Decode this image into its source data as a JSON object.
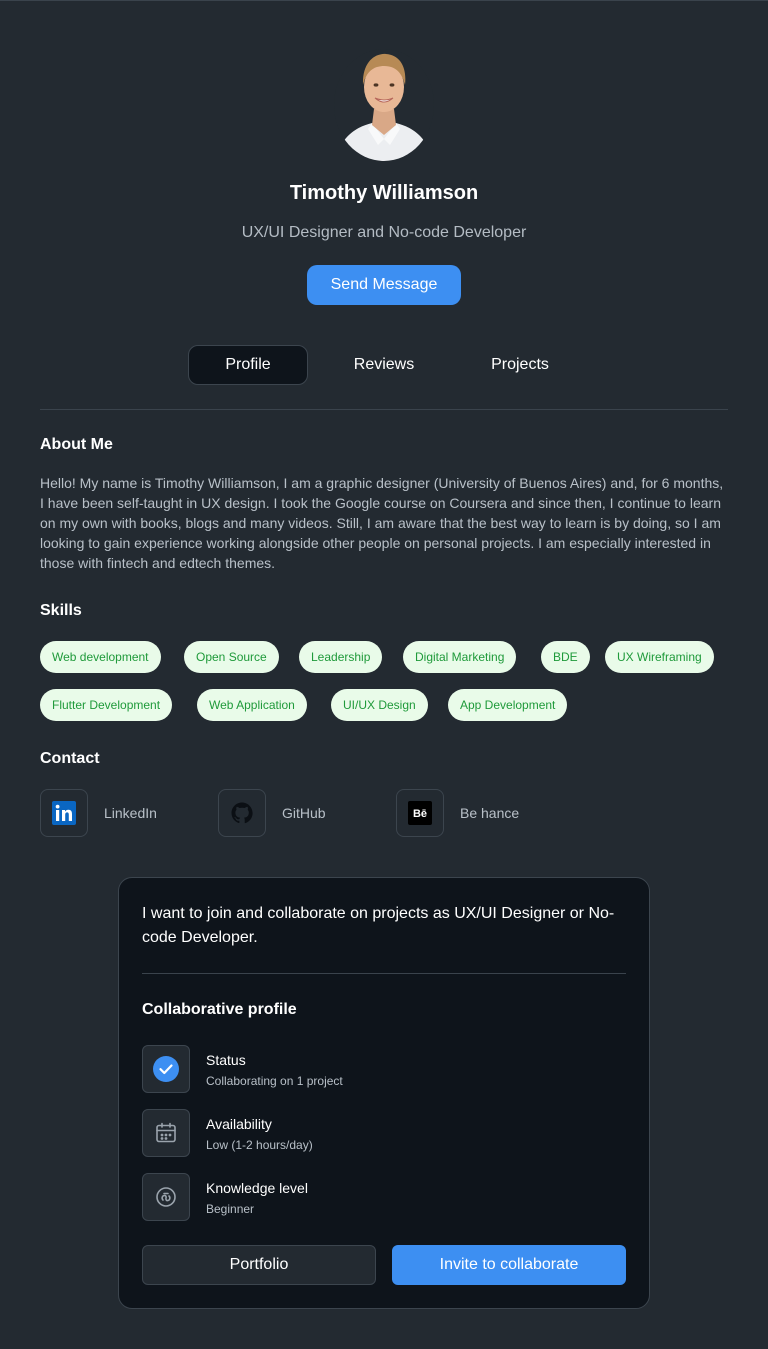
{
  "profile": {
    "name": "Timothy Williamson",
    "role": "UX/UI Designer and No-code Developer",
    "send_message_label": "Send Message"
  },
  "tabs": [
    {
      "label": "Profile",
      "active": true
    },
    {
      "label": "Reviews",
      "active": false
    },
    {
      "label": "Projects",
      "active": false
    }
  ],
  "about": {
    "title": "About Me",
    "text": "Hello! My name is Timothy Williamson, I am a graphic designer (University of Buenos Aires) and, for 6 months, I have been self-taught in UX design. I took the Google course on Coursera and since then, I continue to learn on my own with books, blogs and many videos. Still, I am aware that the best way to learn is by doing, so I am looking to gain experience working alongside other people on personal projects. I am especially interested in those with fintech and edtech themes."
  },
  "skills": {
    "title": "Skills",
    "items": [
      "Web development",
      "Open Source",
      "Leadership",
      "Digital Marketing",
      "BDE",
      "UX Wireframing",
      "Flutter Development",
      "Web Application",
      "UI/UX Design",
      "App Development"
    ]
  },
  "contact": {
    "title": "Contact",
    "items": [
      {
        "label": "LinkedIn",
        "icon": "linkedin-icon"
      },
      {
        "label": "GitHub",
        "icon": "github-icon"
      },
      {
        "label": "Be hance",
        "icon": "behance-icon"
      }
    ]
  },
  "collab_card": {
    "intro": "I want to join and collaborate on projects  as UX/UI Designer or No-code Developer.",
    "title": "Collaborative profile",
    "rows": [
      {
        "label": "Status",
        "value": "Collaborating on 1 project",
        "icon": "check-circle-icon"
      },
      {
        "label": "Availability",
        "value": "Low (1-2 hours/day)",
        "icon": "calendar-icon"
      },
      {
        "label": "Knowledge level",
        "value": "Beginner",
        "icon": "knowledge-icon"
      }
    ],
    "portfolio_label": "Portfolio",
    "invite_label": "Invite to collaborate"
  },
  "colors": {
    "background": "#232a31",
    "card": "#0e141b",
    "accent": "#3d8ff2",
    "chip_bg": "#e9fbe9",
    "chip_text": "#1f9a3a"
  }
}
